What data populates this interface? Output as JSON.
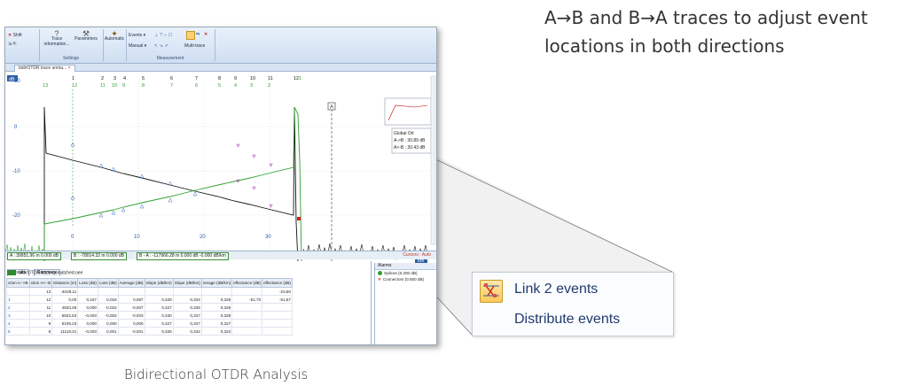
{
  "headline": {
    "line1": "A→B and B→A traces to adjust event",
    "line2": "locations in both directions"
  },
  "caption": "Bidirectional OTDR Analysis",
  "callout": {
    "items": [
      "Link 2 events",
      "Distribute events"
    ],
    "icon": "link-events-icon"
  },
  "ribbon": {
    "shift_label": "Shift",
    "trace_info_label": "Trace information...",
    "parameters_label": "Parameters",
    "automatic_label": "Automatic",
    "events_label": "Events",
    "manual_label": "Manual",
    "multi_trace_label": "Multi-trace",
    "group_settings": "Settings",
    "group_measurement": "Measurement"
  },
  "doc_tab": "bidirOTDR trace unma...",
  "plot": {
    "db_unit": "dB",
    "km_unit": "km",
    "y_ticks": [
      "10",
      "0",
      "-10",
      "-20"
    ],
    "x_ticks": [
      "0",
      "10",
      "20",
      "30"
    ],
    "events_top_black": [
      "1",
      "2",
      "3",
      "4",
      "5",
      "6",
      "7",
      "8",
      "9",
      "10",
      "11",
      "12"
    ],
    "events_top_green": [
      "13",
      "12",
      "11",
      "10",
      "9",
      "8",
      "7",
      "6",
      "5",
      "4",
      "3",
      "2",
      "1"
    ],
    "marker_a": "A",
    "legend": {
      "title": "Global Orl",
      "ab": "A->B : 30.89 dB",
      "ba": "A<-B : 30.43 dB"
    },
    "colors": {
      "ab_trace": "#111111",
      "ba_trace": "#2ca02c",
      "event_marker": "#b040b0",
      "cursor_a": "#c00000"
    }
  },
  "cursor_strip": {
    "a": "A : 39951.96 m  0.000 dB",
    "b": "B : -78014.32 m  0.000 dB",
    "ba": "B - A : -117966.28 m  0.000 dB  -0.000 dB/km",
    "cursors": "Cursors : Auto"
  },
  "results": {
    "tabs": [
      "Results",
      "Summary"
    ],
    "file": "bidirOTDR trace unmatched.oee",
    "columns": [
      "ction A-->B",
      "ction A<--B",
      "Distance (m)",
      "Loss (dB)",
      "Loss (dB)",
      "Average (dB)",
      "Slope (dB/km)",
      "Slope (dB/km)",
      "verage (dB/km)",
      "eflectance (dB)",
      "eflectance (dB)"
    ],
    "rows": [
      [
        "",
        "13",
        "-4029,11",
        "",
        "",
        "",
        "",
        "",
        "",
        "",
        "-23,80"
      ],
      [
        "1",
        "12",
        "0,00",
        "0,157",
        "0,018",
        "0,087",
        "0,328",
        "0,324",
        "0,326",
        "-51,70",
        "-51,87"
      ],
      [
        "2",
        "11",
        "4633,48",
        "0,000",
        "-0,015",
        "-0,007",
        "0,327",
        "0,325",
        "0,326",
        "",
        ""
      ],
      [
        "3",
        "10",
        "6622,53",
        "-0,003",
        "-0,003",
        "-0,003",
        "0,330",
        "0,327",
        "0,328",
        "",
        ""
      ],
      [
        "4",
        "9",
        "8109,23",
        "0,000",
        "0,000",
        "0,000",
        "0,327",
        "0,327",
        "0,327",
        "",
        ""
      ],
      [
        "5",
        "8",
        "11118,31",
        "-0,003",
        "0,001",
        "-0,001",
        "0,326",
        "0,322",
        "0,324",
        "",
        ""
      ]
    ]
  },
  "alarms": {
    "title": "Alarms",
    "splices": "Splices (0.200 dB)",
    "connectors": "Connectors (0.500 dB)"
  }
}
